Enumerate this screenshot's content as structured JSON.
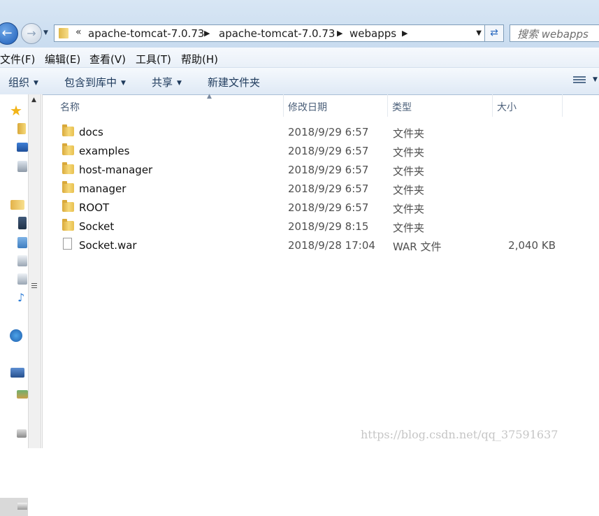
{
  "address_bar": {
    "breadcrumbs": [
      "apache-tomcat-7.0.73",
      "apache-tomcat-7.0.73",
      "webapps"
    ],
    "overflow_glyph": "«",
    "search_placeholder": "搜索 webapps"
  },
  "menu": {
    "items": [
      "文件(F)",
      "编辑(E)",
      "查看(V)",
      "工具(T)",
      "帮助(H)"
    ]
  },
  "toolbar": {
    "organize": "组织",
    "include_in_library": "包含到库中",
    "share": "共享",
    "new_folder": "新建文件夹"
  },
  "columns": {
    "name": "名称",
    "modified": "修改日期",
    "type": "类型",
    "size": "大小"
  },
  "files": [
    {
      "name": "docs",
      "modified": "2018/9/29 6:57",
      "type": "文件夹",
      "size": "",
      "icon": "folder-icon"
    },
    {
      "name": "examples",
      "modified": "2018/9/29 6:57",
      "type": "文件夹",
      "size": "",
      "icon": "folder-icon"
    },
    {
      "name": "host-manager",
      "modified": "2018/9/29 6:57",
      "type": "文件夹",
      "size": "",
      "icon": "folder-icon"
    },
    {
      "name": "manager",
      "modified": "2018/9/29 6:57",
      "type": "文件夹",
      "size": "",
      "icon": "folder-icon"
    },
    {
      "name": "ROOT",
      "modified": "2018/9/29 6:57",
      "type": "文件夹",
      "size": "",
      "icon": "folder-icon"
    },
    {
      "name": "Socket",
      "modified": "2018/9/29 8:15",
      "type": "文件夹",
      "size": "",
      "icon": "folder-icon"
    },
    {
      "name": "Socket.war",
      "modified": "2018/9/28 17:04",
      "type": "WAR 文件",
      "size": "2,040 KB",
      "icon": "file-icon"
    }
  ],
  "watermark": "https://blog.csdn.net/qq_37591637",
  "colors": {
    "address_bg": "#c9dcf0",
    "toolbar_bg": "#dfe9f5",
    "header_text": "#4c607a",
    "folder": "#f6d97a"
  }
}
